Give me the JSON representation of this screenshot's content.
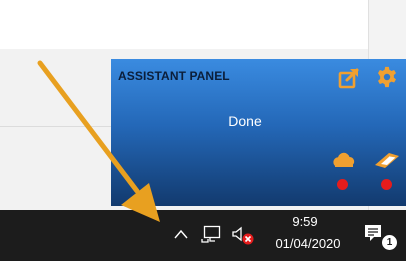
{
  "assistant_panel": {
    "title": "ASSISTANT PANEL",
    "status": "Done",
    "icons": [
      "external-link-icon",
      "gear-icon",
      "cloud-icon",
      "tag-icon"
    ],
    "indicator_color": "#e51c1c",
    "accent_color": "#f0a030"
  },
  "taskbar": {
    "time": "9:59",
    "date": "01/04/2020",
    "notification_count": "1",
    "icons": [
      "chevron-up-icon",
      "network-icon",
      "volume-muted-icon",
      "notification-icon"
    ]
  },
  "annotation": {
    "arrow_color": "#e8a020"
  }
}
